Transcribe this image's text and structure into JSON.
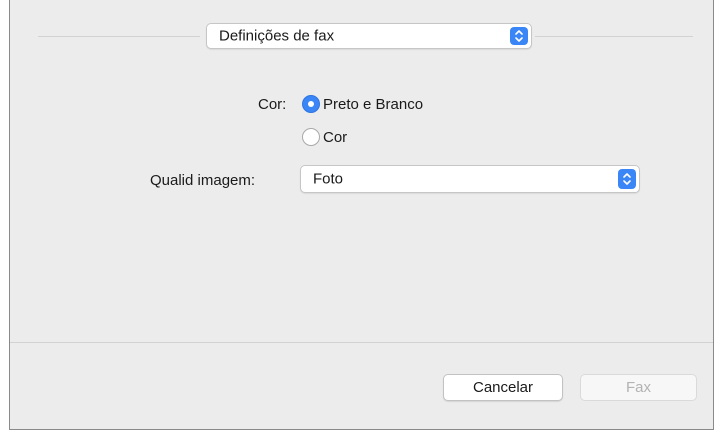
{
  "panel_popup": {
    "selected": "Definições de fax"
  },
  "color": {
    "label": "Cor:",
    "options": [
      {
        "label": "Preto e Branco",
        "selected": true
      },
      {
        "label": "Cor",
        "selected": false
      }
    ]
  },
  "image_quality": {
    "label": "Qualid imagem:",
    "selected": "Foto"
  },
  "buttons": {
    "cancel": "Cancelar",
    "fax": "Fax"
  },
  "colors": {
    "accent": "#3b86f7",
    "dialog_bg": "#ececec",
    "disabled_text": "#b3b3b3"
  },
  "icons": {
    "popup_arrows": "chevron-up-down-icon"
  }
}
